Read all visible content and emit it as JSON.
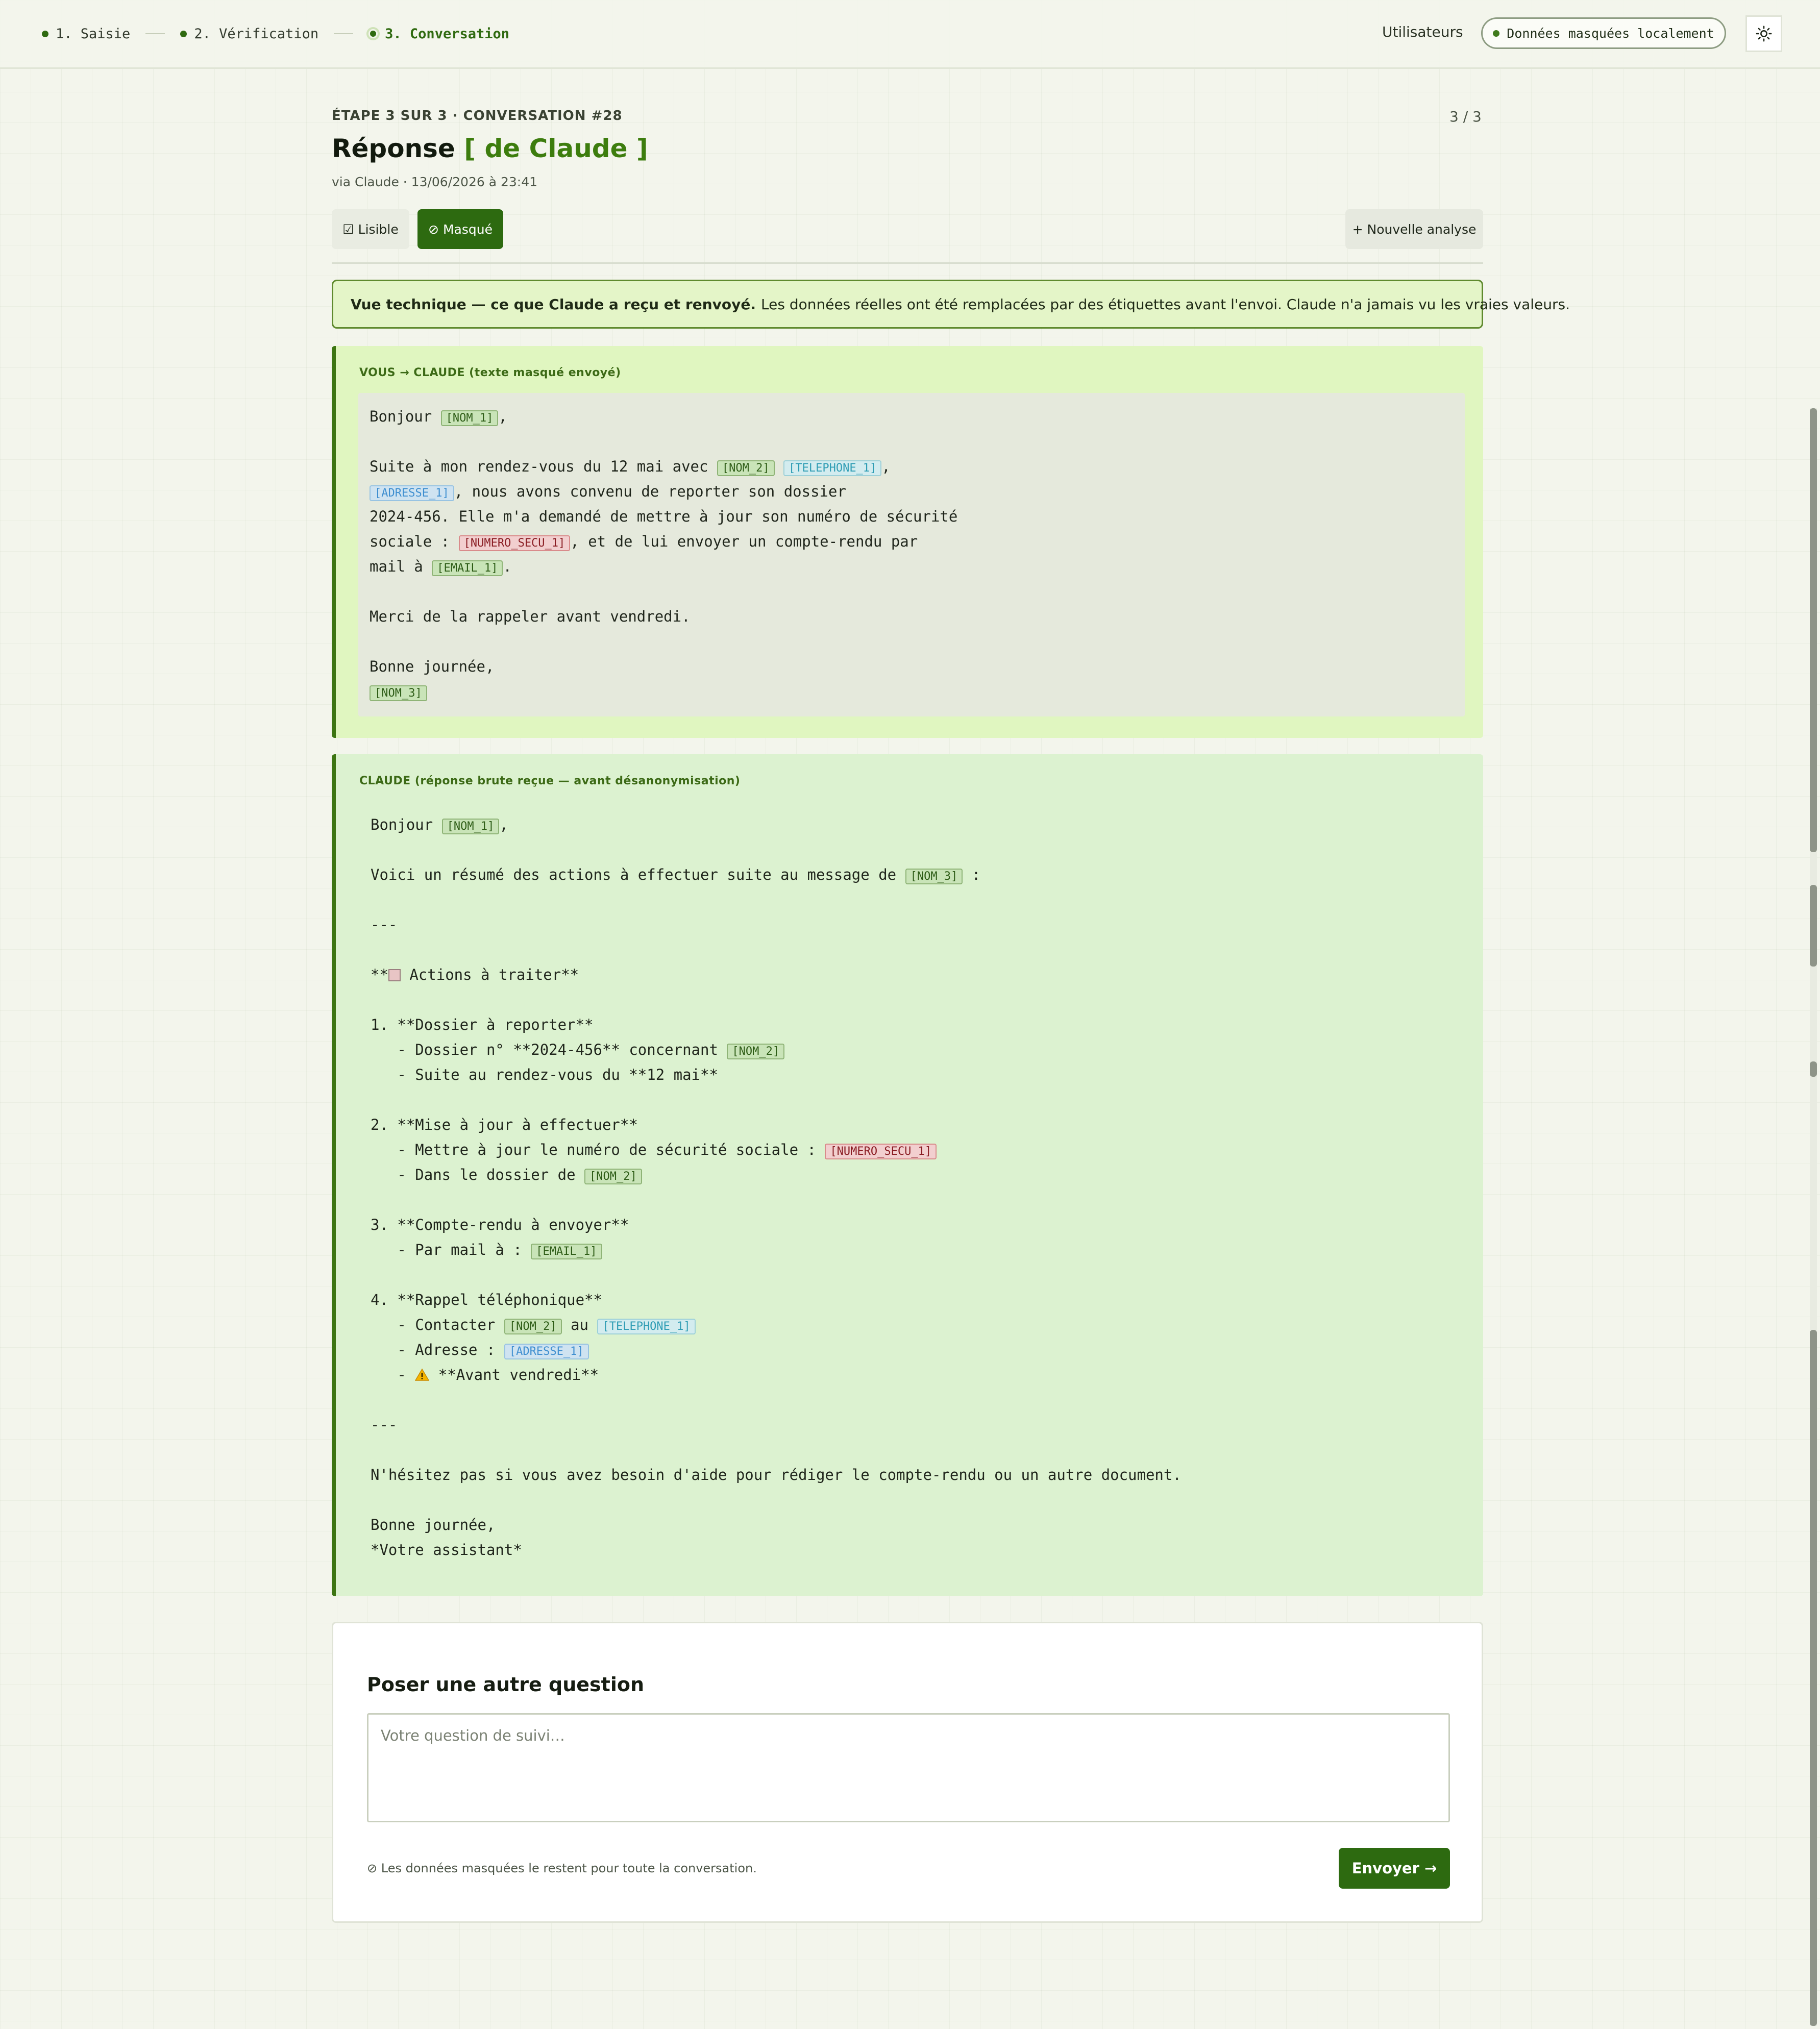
{
  "steps": [
    {
      "label": "1. Saisie",
      "state": "done"
    },
    {
      "label": "2. Vérification",
      "state": "done"
    },
    {
      "label": "3. Conversation",
      "state": "active"
    }
  ],
  "nav": {
    "users_label": "Utilisateurs",
    "mask_pill": "Données masquées localement",
    "theme_icon": "sun-icon"
  },
  "header": {
    "eyebrow": "ÉTAPE 3 SUR 3 · CONVERSATION #28",
    "pager": "3 / 3",
    "title_main": "Réponse",
    "title_accent": "[ de Claude ]",
    "subtitle": "via Claude · 13/06/2026 à 23:41"
  },
  "tabs": {
    "lisible": "☑ Lisible",
    "masque": "⊘ Masqué",
    "active": "masque"
  },
  "new_analysis_label": "+ Nouvelle analyse",
  "banner": {
    "bold": "Vue technique — ce que Claude a reçu et renvoyé.",
    "text": "Les données réelles ont été remplacées par des étiquettes avant l'envoi. Claude n'a jamais vu les vraies valeurs."
  },
  "sent": {
    "label": "VOUS → CLAUDE (texte masqué envoyé)",
    "greeting": "Bonjour ",
    "comma": ",",
    "l1_a": "Suite à mon rendez-vous du 12 mai avec ",
    "l2_a": ", nous avons convenu de reporter son dossier",
    "l3": "2024-456. Elle m'a demandé de mettre à jour son numéro de sécurité",
    "l4_a": "sociale : ",
    "l4_b": ", et de lui envoyer un compte-rendu par",
    "l5_a": "mail à ",
    "period": ".",
    "thanks": "Merci de la rappeler avant vendredi.",
    "closing": "Bonne journée,"
  },
  "received": {
    "label": "CLAUDE (réponse brute reçue — avant désanonymisation)",
    "greeting": "Bonjour ",
    "comma": ",",
    "intro": "Voici un résumé des actions à effectuer suite au message de ",
    "intro_end": " :",
    "sep": "---",
    "actions_a": "**",
    "actions_b": " Actions à traiter**",
    "a1": "1. **Dossier à reporter**",
    "a1_1": "   - Dossier n° **2024-456** concernant ",
    "a1_2": "   - Suite au rendez-vous du **12 mai**",
    "a2": "2. **Mise à jour à effectuer**",
    "a2_1": "   - Mettre à jour le numéro de sécurité sociale : ",
    "a2_2": "   - Dans le dossier de ",
    "a3": "3. **Compte-rendu à envoyer**",
    "a3_1": "   - Par mail à : ",
    "a4": "4. **Rappel téléphonique**",
    "a4_1a": "   - Contacter ",
    "a4_1b": " au ",
    "a4_2": "   - Adresse : ",
    "a4_3a": "   - ",
    "a4_3b": " **Avant vendredi**",
    "help": "N'hésitez pas si vous avez besoin d'aide pour rédiger le compte-rendu ou un autre document.",
    "closing": "Bonne journée,",
    "sign": "*Votre assistant*"
  },
  "tags": {
    "nom1": "[NOM_1]",
    "nom2": "[NOM_2]",
    "nom3": "[NOM_3]",
    "tel1": "[TELEPHONE_1]",
    "addr1": "[ADRESSE_1]",
    "secu1": "[NUMERO_SECU_1]",
    "email1": "[EMAIL_1]"
  },
  "followup": {
    "title": "Poser une autre question",
    "placeholder": "Votre question de suivi…",
    "value": "",
    "note": "⊘ Les données masquées le restent pour toute la conversation.",
    "send_label": "Envoyer →"
  },
  "colors": {
    "accent": "#2d6a10",
    "banner_bg": "#e4f5c8",
    "sent_bg": "#e0f6c0",
    "received_bg": "#dcf2d0",
    "tag_secu": "#8a1d23",
    "tag_phone": "#2f9db4",
    "tag_address": "#3f8fd0"
  }
}
